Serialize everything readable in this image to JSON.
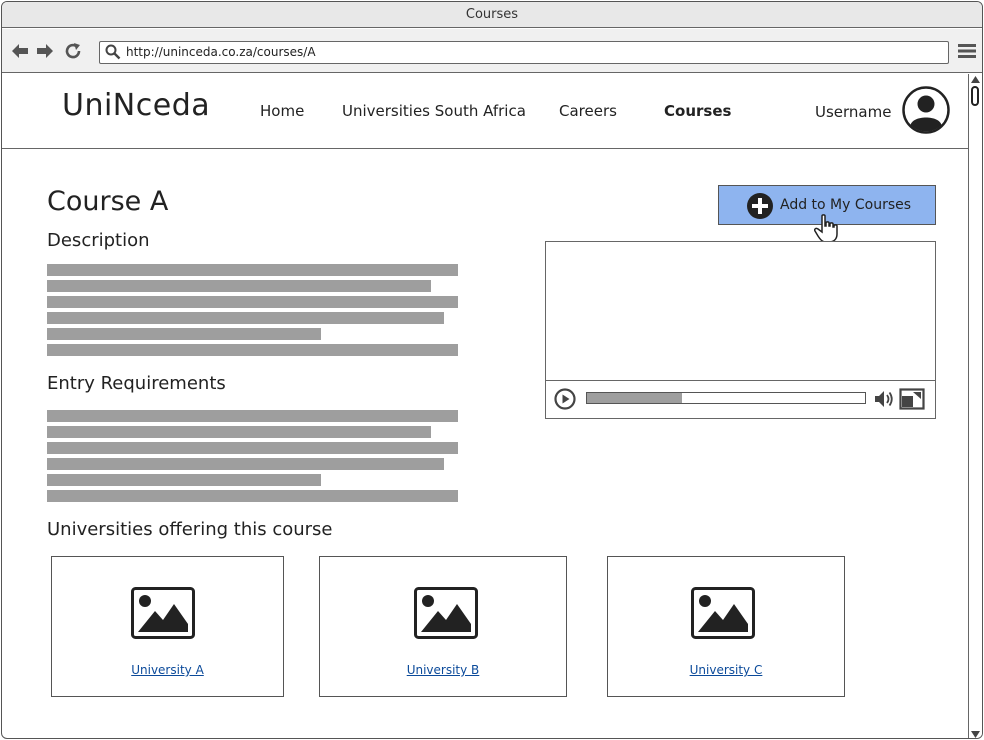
{
  "window": {
    "title": "Courses"
  },
  "browser": {
    "url": "http://uninceda.co.za/courses/A"
  },
  "header": {
    "logo": "UniNceda",
    "nav": [
      {
        "label": "Home"
      },
      {
        "label": "Universities South Africa"
      },
      {
        "label": "Careers"
      },
      {
        "label": "Courses",
        "active": true
      }
    ],
    "username": "Username"
  },
  "course": {
    "title": "Course A",
    "description_heading": "Description",
    "entry_heading": "Entry Requirements",
    "add_button": "Add to My Courses",
    "video_progress": 0.34
  },
  "universities": {
    "heading": "Universities offering this course",
    "items": [
      {
        "label": "University A"
      },
      {
        "label": "University B"
      },
      {
        "label": "University C"
      }
    ]
  },
  "colors": {
    "accent": "#8eb4ef",
    "link": "#0b4a9a",
    "placeholder_text": "#9e9e9e"
  }
}
